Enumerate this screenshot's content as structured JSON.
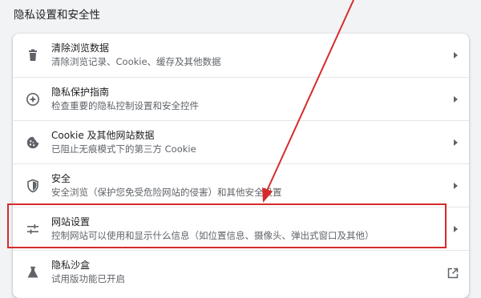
{
  "section": {
    "title": "隐私设置和安全性"
  },
  "rows": [
    {
      "title": "清除浏览数据",
      "subtitle": "清除浏览记录、Cookie、缓存及其他数据",
      "icon": "trash-icon",
      "action": "chevron"
    },
    {
      "title": "隐私保护指南",
      "subtitle": "检查重要的隐私控制设置和安全控件",
      "icon": "privacy-guide-icon",
      "action": "chevron"
    },
    {
      "title": "Cookie 及其他网站数据",
      "subtitle": "已阻止无痕模式下的第三方 Cookie",
      "icon": "cookie-icon",
      "action": "chevron"
    },
    {
      "title": "安全",
      "subtitle": "安全浏览（保护您免受危险网站的侵害）和其他安全设置",
      "icon": "shield-icon",
      "action": "chevron"
    },
    {
      "title": "网站设置",
      "subtitle": "控制网站可以使用和显示什么信息（如位置信息、摄像头、弹出式窗口及其他）",
      "icon": "sliders-icon",
      "action": "chevron"
    },
    {
      "title": "隐私沙盒",
      "subtitle": "试用版功能已开启",
      "icon": "flask-icon",
      "action": "external-link"
    }
  ],
  "colors": {
    "annotation": "#d62b2b",
    "icon": "#5f6368",
    "background": "#f1f3f5"
  }
}
